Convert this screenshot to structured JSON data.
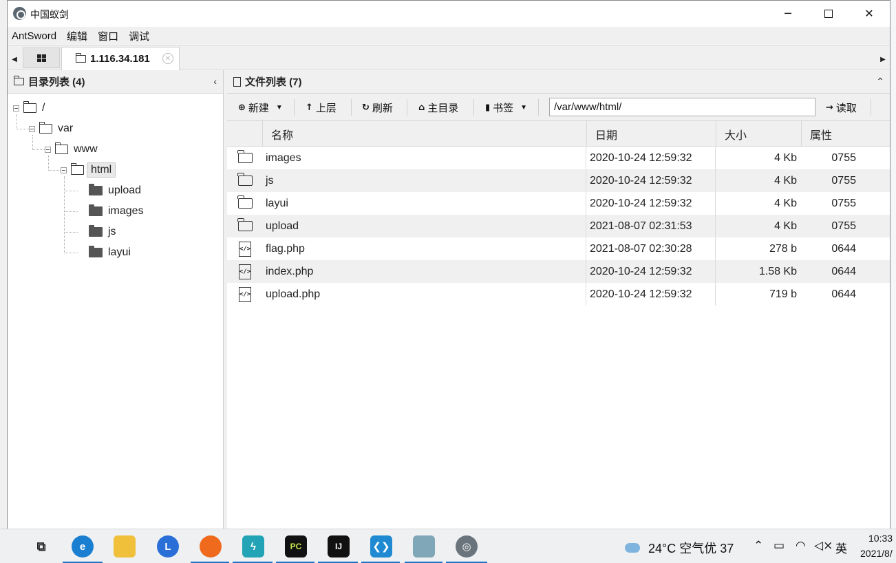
{
  "window": {
    "title": "中国蚁剑",
    "min_glyph": "─",
    "close_glyph": "✕"
  },
  "menu": [
    "AntSword",
    "编辑",
    "窗口",
    "调试"
  ],
  "tabs": {
    "left_arrow": "◀",
    "right_arrow": "▶",
    "host_label": "1.116.34.181",
    "close_glyph": "✕"
  },
  "left_panel": {
    "title": "目录列表 (4)",
    "collapse_glyph": "‹",
    "tree": [
      {
        "label": "/",
        "level": 0
      },
      {
        "label": "var",
        "level": 1
      },
      {
        "label": "www",
        "level": 2
      },
      {
        "label": "html",
        "level": 3,
        "selected": true
      },
      {
        "label": "upload",
        "level": 4
      },
      {
        "label": "images",
        "level": 4
      },
      {
        "label": "js",
        "level": 4
      },
      {
        "label": "layui",
        "level": 4
      }
    ]
  },
  "right_panel": {
    "title": "文件列表 (7)",
    "collapse_glyph": "⌃",
    "toolbar": {
      "new_label": "新建",
      "up_label": "上层",
      "refresh_label": "刷新",
      "home_label": "主目录",
      "bookmark_label": "书签",
      "path_value": "/var/www/html/",
      "read_label": "读取"
    },
    "columns": [
      "名称",
      "日期",
      "大小",
      "属性"
    ],
    "files": [
      {
        "icon": "folder-icon",
        "name": "images",
        "date": "2020-10-24 12:59:32",
        "size": "4 Kb",
        "attr": "0755"
      },
      {
        "icon": "folder-icon",
        "name": "js",
        "date": "2020-10-24 12:59:32",
        "size": "4 Kb",
        "attr": "0755"
      },
      {
        "icon": "folder-icon",
        "name": "layui",
        "date": "2020-10-24 12:59:32",
        "size": "4 Kb",
        "attr": "0755"
      },
      {
        "icon": "folder-icon",
        "name": "upload",
        "date": "2021-08-07 02:31:53",
        "size": "4 Kb",
        "attr": "0755"
      },
      {
        "icon": "code-file-icon",
        "name": "flag.php",
        "date": "2021-08-07 02:30:28",
        "size": "278 b",
        "attr": "0644"
      },
      {
        "icon": "code-file-icon",
        "name": "index.php",
        "date": "2020-10-24 12:59:32",
        "size": "1.58 Kb",
        "attr": "0644"
      },
      {
        "icon": "code-file-icon",
        "name": "upload.php",
        "date": "2020-10-24 12:59:32",
        "size": "719 b",
        "attr": "0644"
      }
    ]
  },
  "taskbar": {
    "apps": [
      "task-view-icon",
      "edge-icon",
      "file-explorer-icon",
      "l-app-icon",
      "firefox-icon",
      "bolt-app-icon",
      "pycharm-icon",
      "intellij-icon",
      "vscode-icon",
      "notes-icon",
      "antsword-icon"
    ],
    "pc_text": "PC",
    "ij_text": "IJ",
    "l_text": "L",
    "weather": "24°C 空气优 37",
    "ime": "英",
    "time": "10:33",
    "date": "2021/8/"
  },
  "colors": {
    "taskbar_accent": "#1a73c9",
    "panel_header_bg": "#f0f0f0",
    "row_alt_bg": "#f0f0f0"
  }
}
